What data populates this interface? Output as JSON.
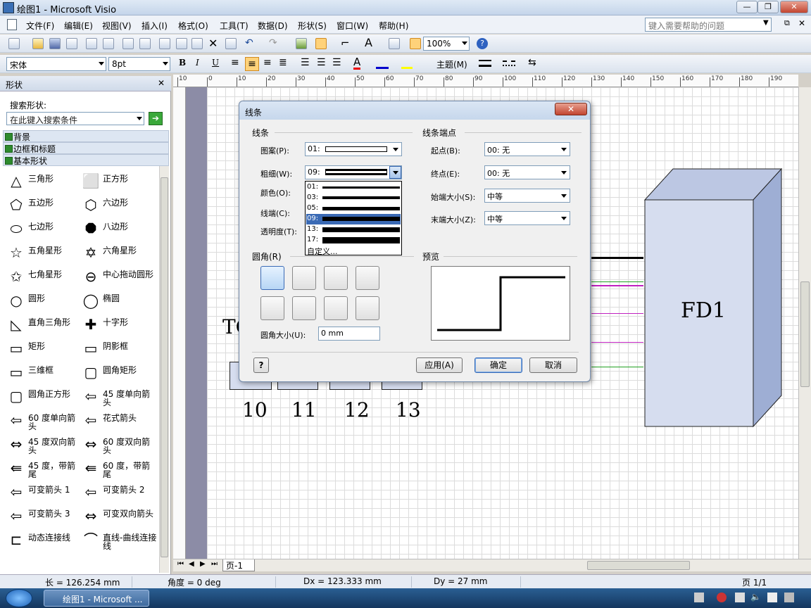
{
  "window": {
    "title": "绘图1 - Microsoft Visio"
  },
  "menu": [
    "文件(F)",
    "编辑(E)",
    "视图(V)",
    "插入(I)",
    "格式(O)",
    "工具(T)",
    "数据(D)",
    "形状(S)",
    "窗口(W)",
    "帮助(H)"
  ],
  "help_placeholder": "键入需要帮助的问题",
  "toolbar": {
    "zoom": "100%",
    "font": "宋体",
    "size": "8pt",
    "theme": "主题(M)"
  },
  "shapes_pane": {
    "title": "形状",
    "search_label": "搜索形状:",
    "search_placeholder": "在此键入搜索条件",
    "stencils": [
      "背景",
      "边框和标题",
      "基本形状"
    ],
    "items": [
      [
        "三角形",
        "正方形"
      ],
      [
        "五边形",
        "六边形"
      ],
      [
        "七边形",
        "八边形"
      ],
      [
        "五角星形",
        "六角星形"
      ],
      [
        "七角星形",
        "中心拖动圆形"
      ],
      [
        "圆形",
        "椭圆"
      ],
      [
        "直角三角形",
        "十字形"
      ],
      [
        "矩形",
        "阴影框"
      ],
      [
        "三维框",
        "圆角矩形"
      ],
      [
        "圆角正方形",
        "45 度单向箭头"
      ],
      [
        "60 度单向箭头",
        "花式箭头"
      ],
      [
        "45 度双向箭头",
        "60 度双向箭头"
      ],
      [
        "45 度，带箭尾",
        "60 度，带箭尾"
      ],
      [
        "可变箭头 1",
        "可变箭头 2"
      ],
      [
        "可变箭头 3",
        "可变双向箭头"
      ],
      [
        "动态连接线",
        "直线-曲线连接线"
      ]
    ]
  },
  "ruler_top": [
    "10",
    "0",
    "10",
    "20",
    "30",
    "40",
    "50",
    "60",
    "70",
    "80",
    "90",
    "100",
    "110",
    "120",
    "130",
    "140",
    "150",
    "160",
    "170",
    "180",
    "190"
  ],
  "canvas": {
    "fd_label": "FD1",
    "to_label": "TO",
    "ports": [
      "10",
      "11",
      "12",
      "13"
    ],
    "page_tab": "页-1"
  },
  "dialog": {
    "title": "线条",
    "group_line": "线条",
    "group_ends": "线条端点",
    "pattern_label": "图案(P):",
    "pattern_value": "01:",
    "weight_label": "粗细(W):",
    "weight_value": "09:",
    "color_label": "颜色(O):",
    "cap_label": "线端(C):",
    "transparency_label": "透明度(T):",
    "begin_label": "起点(B):",
    "begin_value": "00: 无",
    "end_label": "终点(E):",
    "end_value": "00: 无",
    "begin_size_label": "始端大小(S):",
    "begin_size_value": "中等",
    "end_size_label": "末端大小(Z):",
    "end_size_value": "中等",
    "round_label": "圆角(R)",
    "round_size_label": "圆角大小(U):",
    "round_size_value": "0 mm",
    "preview_label": "预览",
    "weights": [
      "01:",
      "03:",
      "05:",
      "09:",
      "13:",
      "17:"
    ],
    "custom": "自定义...",
    "apply": "应用(A)",
    "ok": "确定",
    "cancel": "取消"
  },
  "status": {
    "length": "长 = 126.254 mm",
    "angle": "角度 = 0 deg",
    "dx": "Dx = 123.333 mm",
    "dy": "Dy = 27 mm",
    "page": "页 1/1"
  },
  "taskbar": {
    "app": "绘图1 - Microsoft ..."
  }
}
